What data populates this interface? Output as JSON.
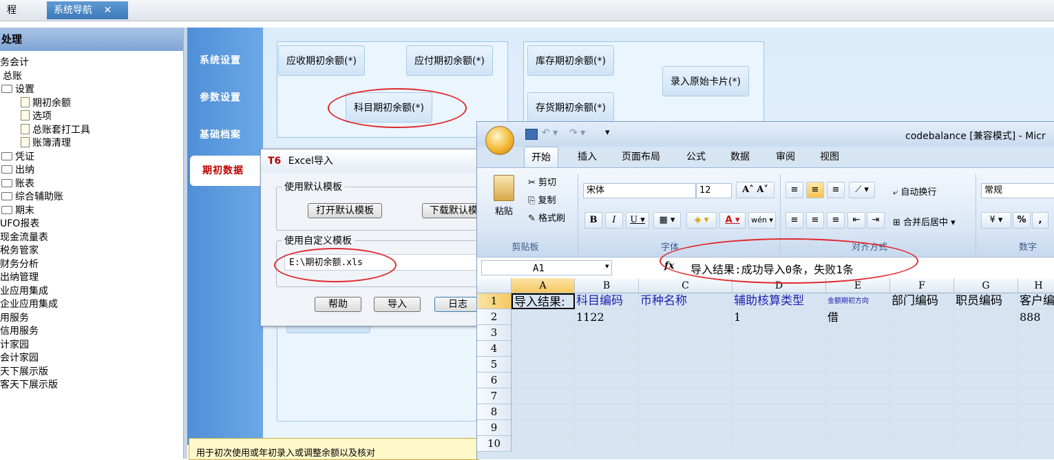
{
  "tabs": {
    "left_fragment": "程",
    "active": "系统导航",
    "close": "✕"
  },
  "tree": {
    "header": "处理",
    "items": [
      {
        "label": "务会计",
        "indent": 0,
        "icon": ""
      },
      {
        "label": "总账",
        "indent": 1,
        "icon": ""
      },
      {
        "label": "设置",
        "indent": 1,
        "icon": "folder"
      },
      {
        "label": "期初余额",
        "indent": 2,
        "icon": "doc"
      },
      {
        "label": "选项",
        "indent": 2,
        "icon": "doc"
      },
      {
        "label": "总账套打工具",
        "indent": 2,
        "icon": "doc"
      },
      {
        "label": "账簿清理",
        "indent": 2,
        "icon": "doc"
      },
      {
        "label": "凭证",
        "indent": 1,
        "icon": "folder"
      },
      {
        "label": "出纳",
        "indent": 1,
        "icon": "folder"
      },
      {
        "label": "账表",
        "indent": 1,
        "icon": "folder"
      },
      {
        "label": "综合辅助账",
        "indent": 1,
        "icon": "folder"
      },
      {
        "label": "期末",
        "indent": 1,
        "icon": "folder"
      },
      {
        "label": "UFO报表",
        "indent": 0,
        "icon": ""
      },
      {
        "label": "现金流量表",
        "indent": 0,
        "icon": ""
      },
      {
        "label": "税务管家",
        "indent": 0,
        "icon": ""
      },
      {
        "label": "财务分析",
        "indent": 0,
        "icon": ""
      },
      {
        "label": "出纳管理",
        "indent": 0,
        "icon": ""
      },
      {
        "label": "业应用集成",
        "indent": 0,
        "icon": ""
      },
      {
        "label": "企业应用集成",
        "indent": 0,
        "icon": ""
      },
      {
        "label": "用服务",
        "indent": 0,
        "icon": ""
      },
      {
        "label": "信用服务",
        "indent": 0,
        "icon": ""
      },
      {
        "label": "计家园",
        "indent": 0,
        "icon": ""
      },
      {
        "label": "会计家园",
        "indent": 0,
        "icon": ""
      },
      {
        "label": "天下展示版",
        "indent": 0,
        "icon": ""
      },
      {
        "label": "客天下展示版",
        "indent": 0,
        "icon": ""
      }
    ]
  },
  "nav": {
    "items": [
      "系统设置",
      "参数设置",
      "基础档案",
      "期初数据"
    ],
    "buttons": {
      "receivable": "应收期初余额(*)",
      "payable": "应付期初余额(*)",
      "subject": "科目期初余额(*)",
      "inventory": "库存期初余额(*)",
      "stock": "存货期初余额(*)",
      "asset_card": "录入原始卡片(*)"
    },
    "tooltip": "用于初次使用或年初录入或调整余额以及核对"
  },
  "dialog": {
    "brand": "T6",
    "title": "Excel导入",
    "default_group": "使用默认模板",
    "open_default": "打开默认模板",
    "download_default": "下载默认模",
    "custom_group": "使用自定义模板",
    "path": "E:\\期初余额.xls",
    "help": "帮助",
    "import": "导入",
    "log": "日志"
  },
  "excel": {
    "title": "codebalance  [兼容模式] - Micr",
    "ribbon_tabs": [
      "开始",
      "插入",
      "页面布局",
      "公式",
      "数据",
      "审阅",
      "视图"
    ],
    "clipboard": {
      "paste": "粘贴",
      "cut": "剪切",
      "copy": "复制",
      "format_painter": "格式刷",
      "label": "剪贴板"
    },
    "font": {
      "name": "宋体",
      "size": "12",
      "label": "字体"
    },
    "alignment": {
      "wrap": "自动换行",
      "merge": "合并后居中",
      "label": "对齐方式"
    },
    "number": {
      "format": "常规",
      "label": "数字"
    },
    "name_box": "A1",
    "fx": "fx",
    "formula": "导入结果:成功导入0条，失败1条",
    "columns": [
      "A",
      "B",
      "C",
      "D",
      "E",
      "F",
      "G",
      "H"
    ],
    "rows": [
      "1",
      "2",
      "3",
      "4",
      "5",
      "6",
      "7",
      "8",
      "9",
      "10"
    ],
    "row1": [
      "导入结果:",
      "科目编码",
      "币种名称",
      "辅助核算类型",
      "金额期初方向",
      "部门编码",
      "职员编码",
      "客户编"
    ],
    "row2": [
      "",
      "1122",
      "",
      "1",
      "借",
      "",
      "",
      "888"
    ]
  },
  "colors": {
    "accent_red": "#e0282d",
    "excel_blue_text": "#2020b0",
    "nav_blue": "#4f8fd6"
  }
}
